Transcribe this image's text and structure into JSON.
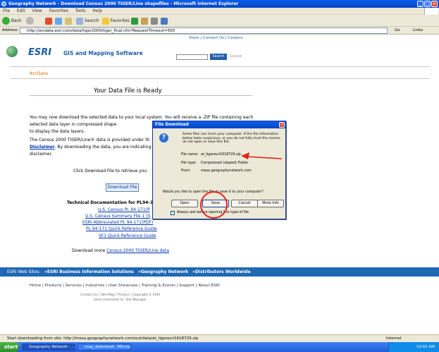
{
  "window": {
    "title": "Geography Network - Download Census 2000 TIGER/Line shapefiles - Microsoft Internet Explorer"
  },
  "menu": [
    "File",
    "Edit",
    "View",
    "Favorites",
    "Tools",
    "Help"
  ],
  "toolbar": {
    "back": "Back",
    "search": "Search",
    "favorites": "Favorites"
  },
  "address": {
    "label": "Address",
    "url": "http://arcdata.esri.com/data/tiger2000/tiger_final.cfm?RequestTimeout=500",
    "go": "Go",
    "links": "Links"
  },
  "site": {
    "topnav": "Store  |  Contact Us  |  Careers",
    "brand": "ESRI",
    "tagline": "GIS and Mapping Software",
    "search_label": "Search",
    "google": "Google",
    "section": "ArcData",
    "heading": "Your Data File is Ready",
    "p1": "You may now download the selected data to your local system. You will receive a .ZIP file containing each selected data layer in compressed shape",
    "p1b": "to display the data layers.",
    "p2": "The Census 2000 TIGER/Line® data is provided under th",
    "p2_link": "Disclaimer",
    "p2b": ". By downloading the data, you are indicating",
    "p2c": "disclaimer.",
    "click_text": "Click Download File to retrieve you",
    "download_button": "Download File",
    "techdoc": "Technical Documentation for PL94-17",
    "doc_links": [
      "U.S. Census PL 94-171(P",
      "U.S. Census Summary File 1 (S",
      "ESRI Abbreviated PL 94-171(PDF)",
      "PL 94-171 Quick Reference Guide",
      "SF1 Quick Reference Guide"
    ],
    "download_more": "Download more",
    "download_more_link": "Census 2000 TIGER/Line data",
    "esri_sites_label": "ESRI Web Sites:",
    "esri_sites": [
      "»ESRI Business Information Solutions",
      "»Geography Network",
      "»Distributors Worldwide"
    ],
    "footer_links": "Home  |  Products  |  Services  |  Industries  |  User Showcase  |  Training & Events  |  Support  |  About ESRI",
    "footer_small1": "Contact Us  |  Site Map  |  Privacy  |  Copyright © ESRI",
    "footer_small2": "Send comments to:  Site Manager"
  },
  "dialog": {
    "title": "File Download",
    "warning": "Some files can harm your computer. If the file information below looks suspicious, or you do not fully trust the source, do not open or save this file.",
    "file_name_label": "File name:",
    "file_name": "at_tigeresri1618729.zip",
    "file_type_label": "File type:",
    "file_type": "Compressed (zipped) Folder",
    "from_label": "From:",
    "from": "mesa.geographynetwork.com",
    "question": "Would you like to open the file or save it to your computer?",
    "buttons": [
      "Open",
      "Save",
      "Cancel",
      "More Info"
    ],
    "always_ask": "Always ask before opening this type of file"
  },
  "status": {
    "text": "Start downloading from site: http://mesa.geographynetwork.com/out/data/at_tigeresri1618729.zip",
    "zone": "Internet"
  },
  "taskbar": {
    "start": "start",
    "items": [
      "Geography Network - ...",
      "map_download - Microso..."
    ],
    "clock": "10:02 AM"
  }
}
